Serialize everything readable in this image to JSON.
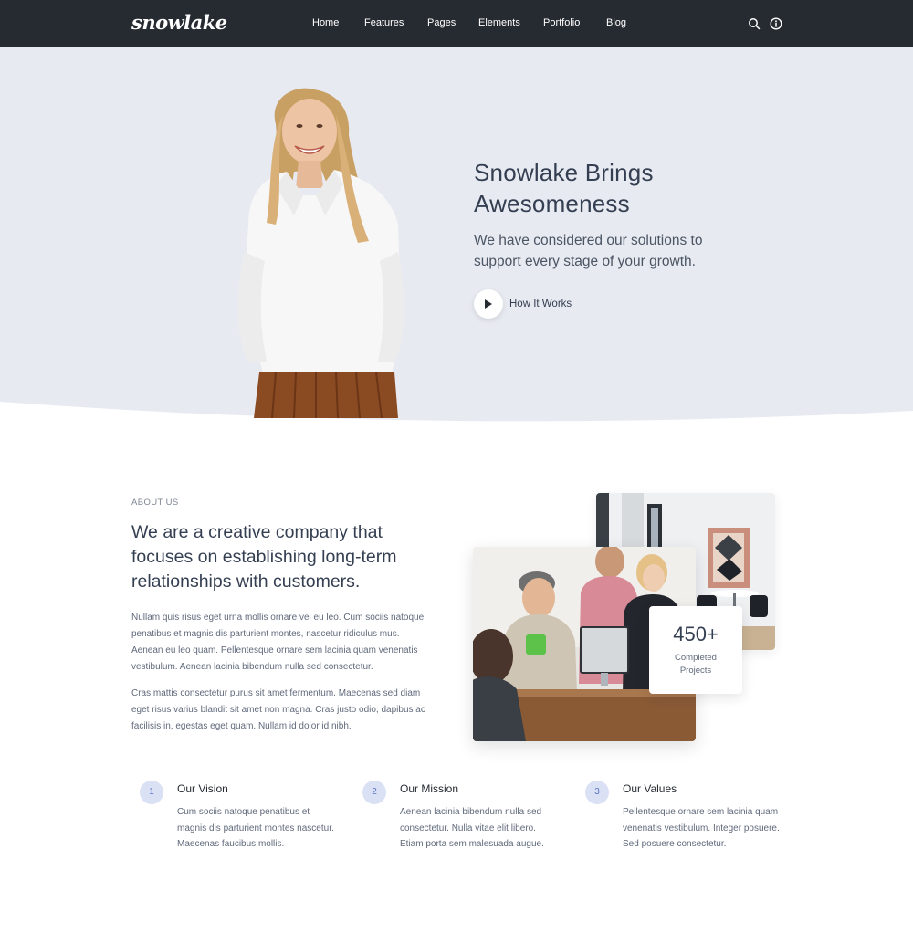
{
  "brand": {
    "logo_text": "snowlake"
  },
  "nav": {
    "items": [
      "Home",
      "Features",
      "Pages",
      "Elements",
      "Portfolio",
      "Blog"
    ],
    "icons": [
      "search-icon",
      "info-icon"
    ]
  },
  "hero": {
    "title_line1": "Snowlake Brings",
    "title_line2": "Awesomeness",
    "lead": "We have considered our solutions to support every stage of your growth.",
    "cta_label": "How It Works"
  },
  "about": {
    "eyebrow": "ABOUT US",
    "title": "We are a creative company that focuses on establishing long-term relationships with customers.",
    "paragraph1": "Nullam quis risus eget urna mollis ornare vel eu leo. Cum sociis natoque penatibus et magnis dis parturient montes, nascetur ridiculus mus. Aenean eu leo quam. Pellentesque ornare sem lacinia quam venenatis vestibulum. Aenean lacinia bibendum nulla sed consectetur.",
    "paragraph2": "Cras mattis consectetur purus sit amet fermentum. Maecenas sed diam eget risus varius blandit sit amet non magna. Cras justo odio, dapibus ac facilisis in, egestas eget quam. Nullam id dolor id nibh.",
    "stat_number": "450+",
    "stat_label_line1": "Completed",
    "stat_label_line2": "Projects"
  },
  "features": [
    {
      "number": "1",
      "title": "Our Vision",
      "text": "Cum sociis natoque penatibus et magnis dis parturient montes nascetur. Maecenas faucibus mollis."
    },
    {
      "number": "2",
      "title": "Our Mission",
      "text": "Aenean lacinia bibendum nulla sed consectetur. Nulla vitae elit libero. Etiam porta sem malesuada augue."
    },
    {
      "number": "3",
      "title": "Our Values",
      "text": "Pellentesque ornare sem lacinia quam venenatis vestibulum. Integer posuere. Sed posuere consectetur."
    }
  ],
  "colors": {
    "navbar": "#262b32",
    "hero_background": "#e8eaf1",
    "heading": "#343f52",
    "body_text": "#60697b",
    "accent_soft": "#dbe1f5",
    "accent": "#5a75c9"
  }
}
